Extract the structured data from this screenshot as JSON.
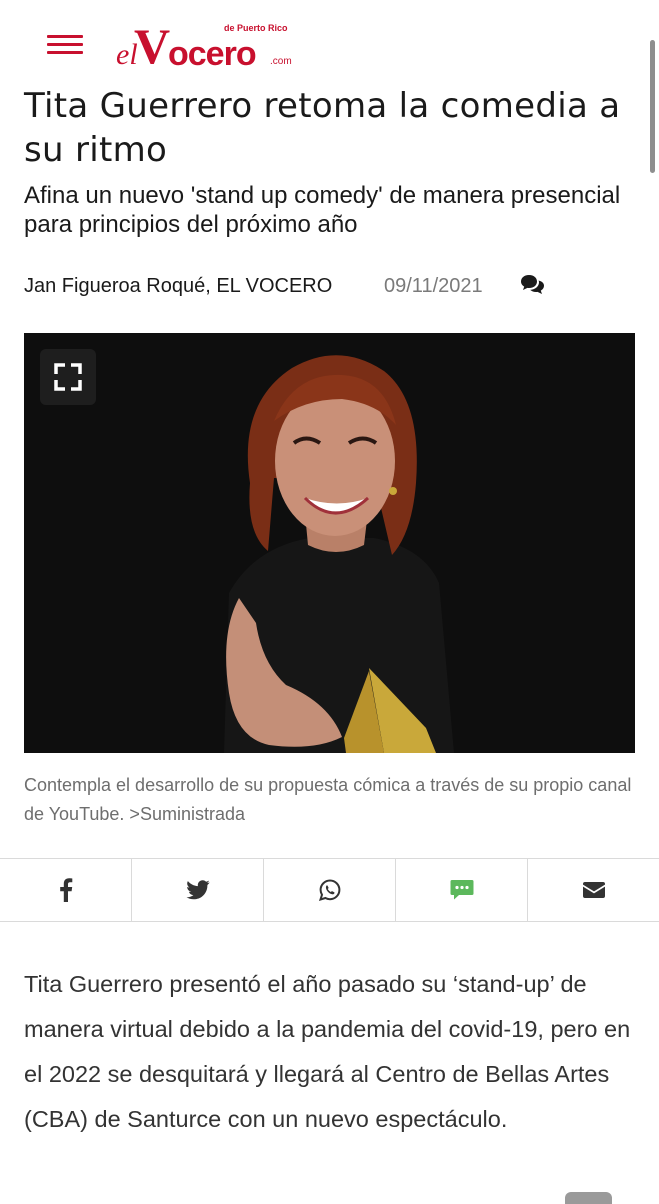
{
  "header": {
    "menu_icon": "hamburger-menu-icon",
    "logo": {
      "prefix": "el",
      "big_letter": "V",
      "name_rest": "ocero",
      "tagline": "de Puerto Rico",
      "suffix": ".com"
    },
    "brand_color": "#c8102e"
  },
  "article": {
    "title": "Tita Guerrero retoma la comedia a su ritmo",
    "subtitle": "Afina un nuevo 'stand up comedy' de manera presencial para principios del próximo año",
    "author": "Jan Figueroa Roqué, EL VOCERO",
    "date": "09/11/2021",
    "comment_icon": "comments-icon"
  },
  "photo": {
    "expand_icon": "expand-icon",
    "caption": "Contempla el desarrollo de su propuesta cómica a través de su propio canal de YouTube. >Suministrada"
  },
  "share": {
    "buttons": [
      {
        "icon": "facebook-icon",
        "color": "#333333"
      },
      {
        "icon": "twitter-icon",
        "color": "#333333"
      },
      {
        "icon": "whatsapp-icon",
        "color": "#333333"
      },
      {
        "icon": "sms-icon",
        "color": "#5cb85c"
      },
      {
        "icon": "email-icon",
        "color": "#333333"
      }
    ]
  },
  "body": {
    "paragraph_1": "Tita Guerrero presentó el año pasado su ‘stand-up’ de manera virtual debido a la pandemia del covid-19, pero en el 2022 se desquitará y llegará al Centro de Bellas Artes (CBA) de Santurce con un nuevo espectáculo."
  }
}
